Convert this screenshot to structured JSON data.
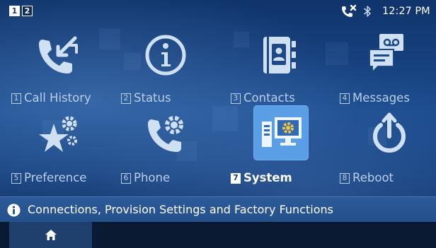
{
  "status_bar": {
    "accounts": [
      "1",
      "2"
    ],
    "time": "12:27 PM",
    "icons": [
      "dnd-phone-icon",
      "bluetooth-icon"
    ]
  },
  "menu": {
    "items": [
      {
        "number": "1",
        "label": "Call History",
        "icon": "call-history-icon"
      },
      {
        "number": "2",
        "label": "Status",
        "icon": "info-circle-icon"
      },
      {
        "number": "3",
        "label": "Contacts",
        "icon": "contacts-book-icon"
      },
      {
        "number": "4",
        "label": "Messages",
        "icon": "voicemail-message-icon"
      },
      {
        "number": "5",
        "label": "Preference",
        "icon": "star-gear-icon"
      },
      {
        "number": "6",
        "label": "Phone",
        "icon": "phone-gear-icon"
      },
      {
        "number": "7",
        "label": "System",
        "icon": "system-computer-icon"
      },
      {
        "number": "8",
        "label": "Reboot",
        "icon": "power-reboot-icon"
      }
    ],
    "selected_index": 6
  },
  "info_bar": {
    "icon": "info-icon",
    "text": "Connections, Provision Settings and Factory Functions"
  },
  "nav_bar": {
    "tabs": [
      {
        "icon": "home-icon",
        "active": true
      }
    ]
  },
  "colors": {
    "selected_bg": "#5a9ee6",
    "info_bar": "#2d5a99",
    "nav_bar": "#0b1a33"
  }
}
